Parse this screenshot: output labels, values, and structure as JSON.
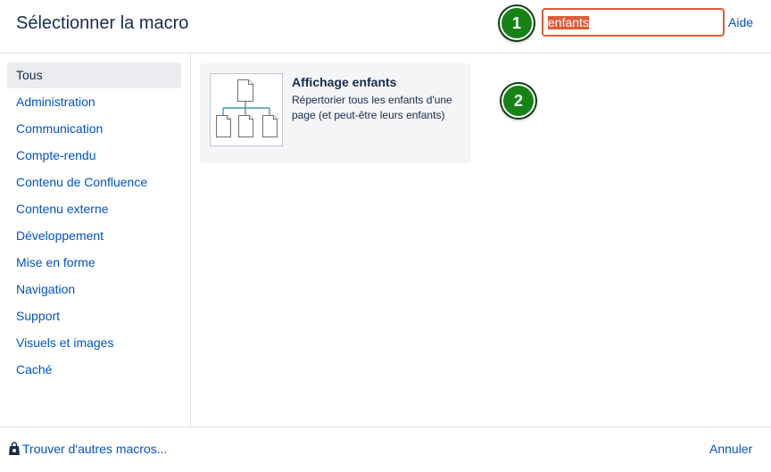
{
  "header": {
    "title": "Sélectionner la macro",
    "search_value": "enfants",
    "help_label": "Aide"
  },
  "callouts": [
    "1",
    "2"
  ],
  "categories": [
    {
      "label": "Tous",
      "active": true
    },
    {
      "label": "Administration"
    },
    {
      "label": "Communication"
    },
    {
      "label": "Compte-rendu"
    },
    {
      "label": "Contenu de Confluence"
    },
    {
      "label": "Contenu externe"
    },
    {
      "label": "Développement"
    },
    {
      "label": "Mise en forme"
    },
    {
      "label": "Navigation"
    },
    {
      "label": "Support"
    },
    {
      "label": "Visuels et images"
    },
    {
      "label": "Caché"
    }
  ],
  "results": [
    {
      "name": "Affichage enfants",
      "description": "Répertorier tous les enfants d'une page (et peut-être leurs enfants)",
      "icon": "page-tree-icon"
    }
  ],
  "footer": {
    "find_more_label": "Trouver d'autres macros...",
    "find_more_icon": "marketplace-bag-icon",
    "cancel_label": "Annuler"
  },
  "colors": {
    "link": "#0052cc",
    "search_highlight": "#de5b3a",
    "callout": "#178316",
    "active_category_bg": "#ebecf0"
  }
}
